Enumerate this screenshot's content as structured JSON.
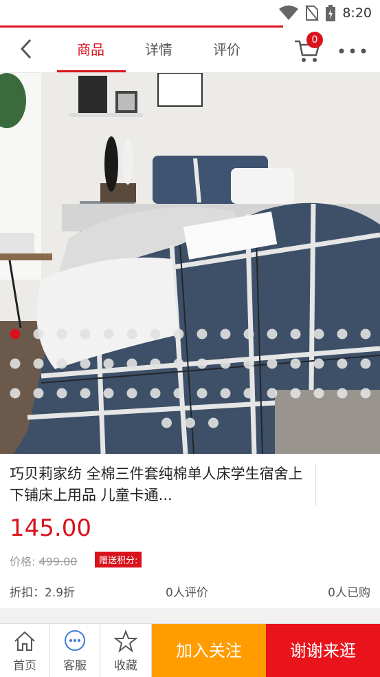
{
  "status": {
    "time": "8:20"
  },
  "header": {
    "tabs": [
      {
        "label": "商品",
        "active": true
      },
      {
        "label": "详情",
        "active": false
      },
      {
        "label": "评价",
        "active": false
      }
    ],
    "cart_count": "0",
    "accent_color": "#d8131c"
  },
  "product": {
    "title": "巧贝莉家纺 全棉三件套纯棉单人床学生宿舍上下铺床上用品 儿童卡通...",
    "price": "145.00",
    "original_price_label": "价格:",
    "original_price": "499.00",
    "points_label": "赠送积分:",
    "discount": "折扣：2.9折",
    "reviews": "0人评价",
    "sold": "0人已购",
    "image_page": 1,
    "image_total": 51
  },
  "bottom_bar": {
    "home": "首页",
    "service": "客服",
    "favorite": "收藏",
    "follow_button": "加入关注",
    "shop_button": "谢谢来逛",
    "follow_color": "#ff9c00",
    "shop_color": "#e8131b"
  }
}
